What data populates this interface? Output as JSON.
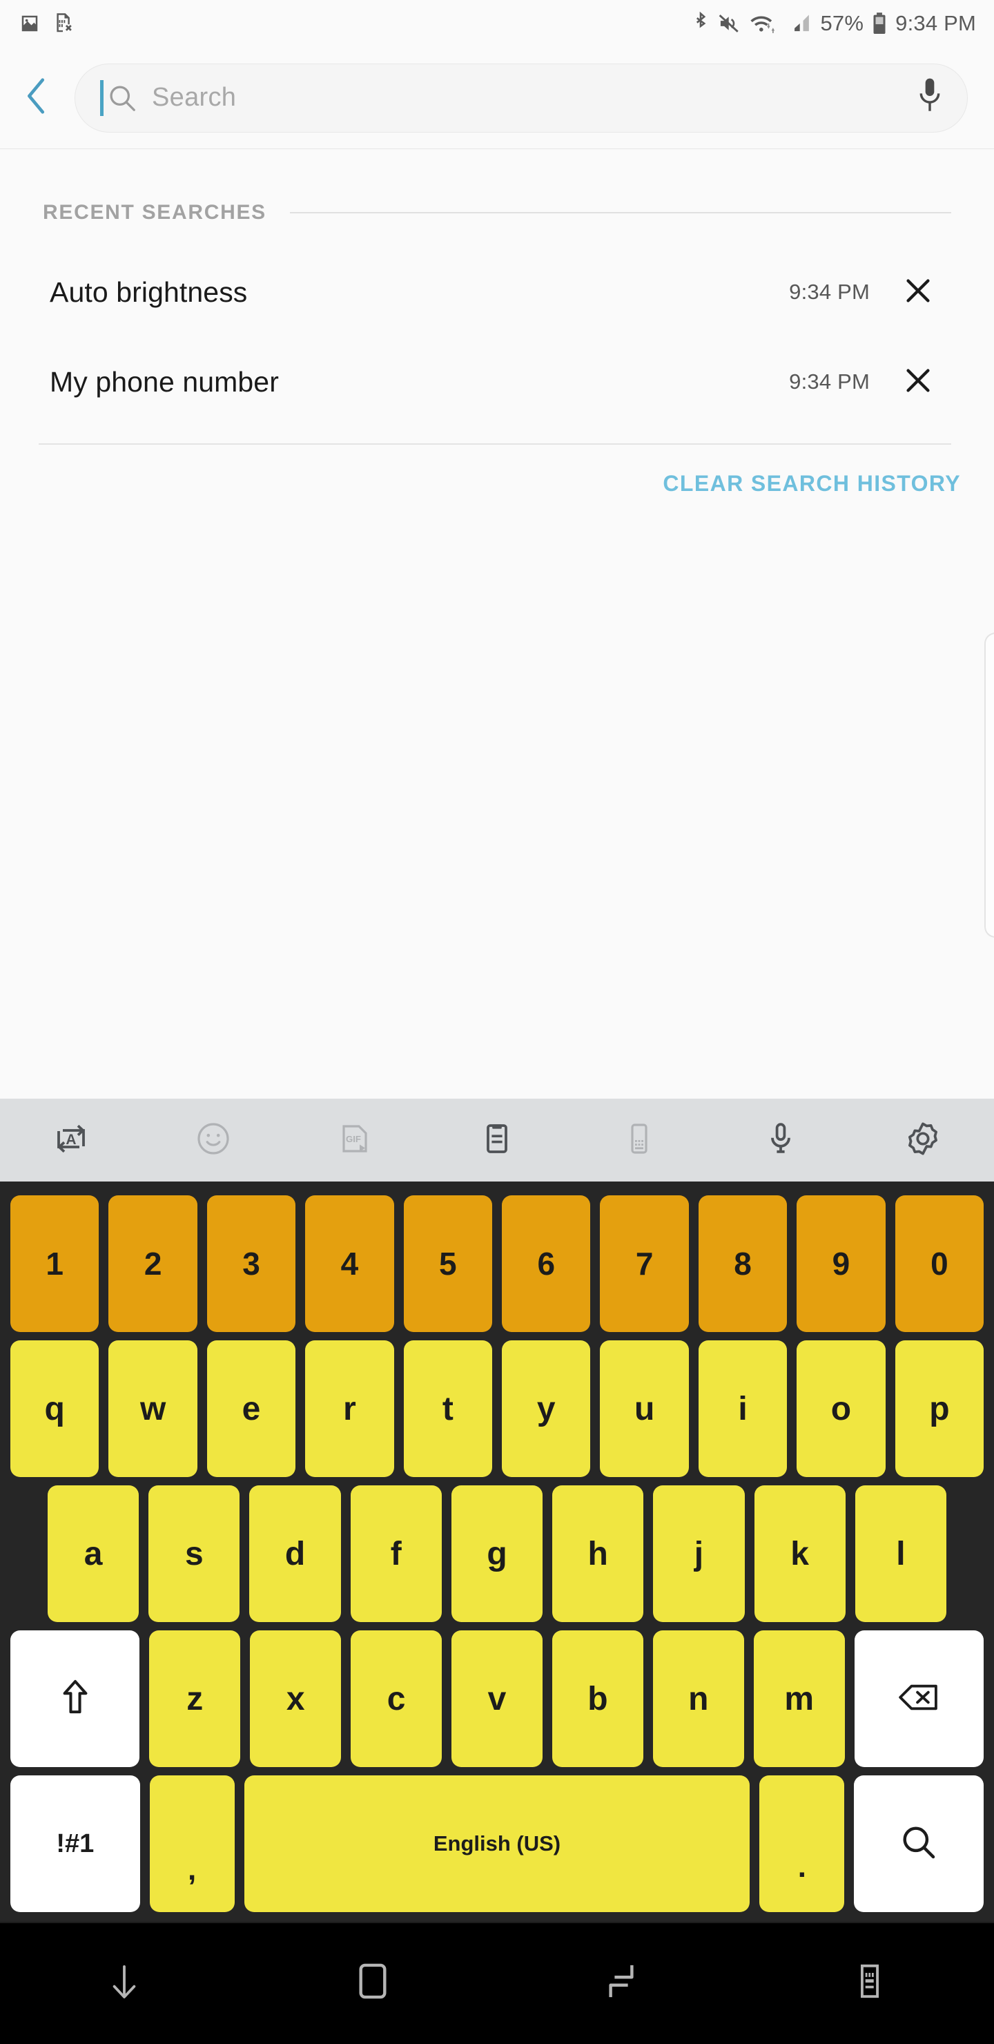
{
  "status_bar": {
    "left_icons": [
      "image-icon",
      "sim-card-off-icon"
    ],
    "right_icons": [
      "bluetooth-icon",
      "mute-icon",
      "wifi-icon",
      "signal-icon",
      "battery-icon"
    ],
    "battery_percent": "57%",
    "time": "9:34 PM"
  },
  "search_header": {
    "back_icon": "back-chevron-icon",
    "search_icon": "search-icon",
    "placeholder": "Search",
    "value": "",
    "mic_icon": "microphone-icon"
  },
  "content": {
    "section_title": "RECENT SEARCHES",
    "recent_searches": [
      {
        "label": "Auto brightness",
        "time": "9:34 PM",
        "remove_icon": "close-x-icon"
      },
      {
        "label": "My phone number",
        "time": "9:34 PM",
        "remove_icon": "close-x-icon"
      }
    ],
    "clear_history_label": "CLEAR SEARCH HISTORY"
  },
  "keyboard_toolbar": {
    "items": [
      {
        "icon": "translate-icon",
        "dim": false
      },
      {
        "icon": "emoji-icon",
        "dim": true
      },
      {
        "icon": "gif-icon",
        "dim": true
      },
      {
        "icon": "clipboard-icon",
        "dim": false
      },
      {
        "icon": "keyboard-layout-icon",
        "dim": true
      },
      {
        "icon": "microphone-icon",
        "dim": false
      },
      {
        "icon": "settings-gear-icon",
        "dim": false
      }
    ]
  },
  "keyboard": {
    "row_numbers": [
      "1",
      "2",
      "3",
      "4",
      "5",
      "6",
      "7",
      "8",
      "9",
      "0"
    ],
    "row_top": [
      "q",
      "w",
      "e",
      "r",
      "t",
      "y",
      "u",
      "i",
      "o",
      "p"
    ],
    "row_home": [
      "a",
      "s",
      "d",
      "f",
      "g",
      "h",
      "j",
      "k",
      "l"
    ],
    "row_bottom": [
      "z",
      "x",
      "c",
      "v",
      "b",
      "n",
      "m"
    ],
    "shift_icon": "shift-arrow-icon",
    "backspace_icon": "backspace-icon",
    "symbols_label": "!#1",
    "comma_label": ",",
    "space_label": "English (US)",
    "period_label": ".",
    "enter_icon": "search-icon",
    "colors": {
      "number_key": "#e4a00f",
      "letter_key": "#f0e641",
      "function_key": "#ffffff",
      "background": "#262626"
    }
  },
  "nav_bar": {
    "buttons": [
      {
        "icon": "hide-keyboard-down-arrow-icon"
      },
      {
        "icon": "home-icon"
      },
      {
        "icon": "recents-icon"
      },
      {
        "icon": "keyboard-switch-icon"
      }
    ]
  },
  "theme": {
    "accent_blue": "#6fbfdd",
    "page_background": "#fafafa",
    "toolbar_background": "#dcdee0"
  }
}
